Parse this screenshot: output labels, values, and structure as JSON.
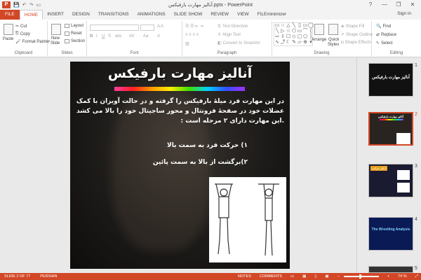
{
  "window": {
    "title": "آنالیز مهارت بارفیکس.pptx - PowerPoint",
    "app_letter": "P",
    "sign_in": "Sign in",
    "controls": [
      "?",
      "—",
      "❐",
      "✕"
    ]
  },
  "tabs": [
    "FILE",
    "HOME",
    "INSERT",
    "DESIGN",
    "TRANSITIONS",
    "ANIMATIONS",
    "SLIDE SHOW",
    "REVIEW",
    "VIEW",
    "FILEminimizer"
  ],
  "ribbon": {
    "clipboard": {
      "label": "Clipboard",
      "paste": "Paste",
      "cut": "Cut",
      "copy": "Copy",
      "format_painter": "Format Painter"
    },
    "slides": {
      "label": "Slides",
      "new_slide": "New",
      "new_slide2": "Slide",
      "layout": "Layout",
      "reset": "Reset",
      "section": "Section"
    },
    "font": {
      "label": "Font"
    },
    "paragraph": {
      "label": "Paragraph",
      "text_direction": "Text Direction",
      "align_text": "Align Text",
      "convert_smartart": "Convert to SmartArt"
    },
    "drawing": {
      "label": "Drawing",
      "arrange": "Arrange",
      "quick_styles": "Quick",
      "quick_styles2": "Styles",
      "shape_fill": "Shape Fill",
      "shape_outline": "Shape Outline",
      "shape_effects": "Shape Effects"
    },
    "editing": {
      "label": "Editing",
      "find": "Find",
      "replace": "Replace",
      "select": "Select"
    }
  },
  "slide": {
    "title": "آنالیز مهارت بارفیکس",
    "paragraph": "در این مهارت فرد میلهٔ بارفیکس را گرفته و در حالت آویزان با کمک عضلات خود در صفحهٔ فرونتال و محور ساجیتال خود را بالا می کشد .این مهارت دارای ۲ مرحله است :",
    "bullet1": "۱) حرکت فرد به سمت بالا",
    "bullet2": "۲)برگشت از بالا به سمت پائین"
  },
  "thumbnails": [
    {
      "num": "1",
      "title": "آنالیز مهارت بارفیکس"
    },
    {
      "num": "2",
      "title": "آنالیز مهارت بارفیکس"
    },
    {
      "num": "3",
      "title": "آنالیز حرکت"
    },
    {
      "num": "4",
      "title": "The Wrestling Analysis"
    },
    {
      "num": "5",
      "title": ""
    }
  ],
  "statusbar": {
    "slide_of": "SLIDE 2 OF 77",
    "language": "PERSIAN",
    "notes": "NOTES",
    "comments": "COMMENTS",
    "zoom": "74 %"
  },
  "colors": {
    "accent": "#d24726"
  }
}
